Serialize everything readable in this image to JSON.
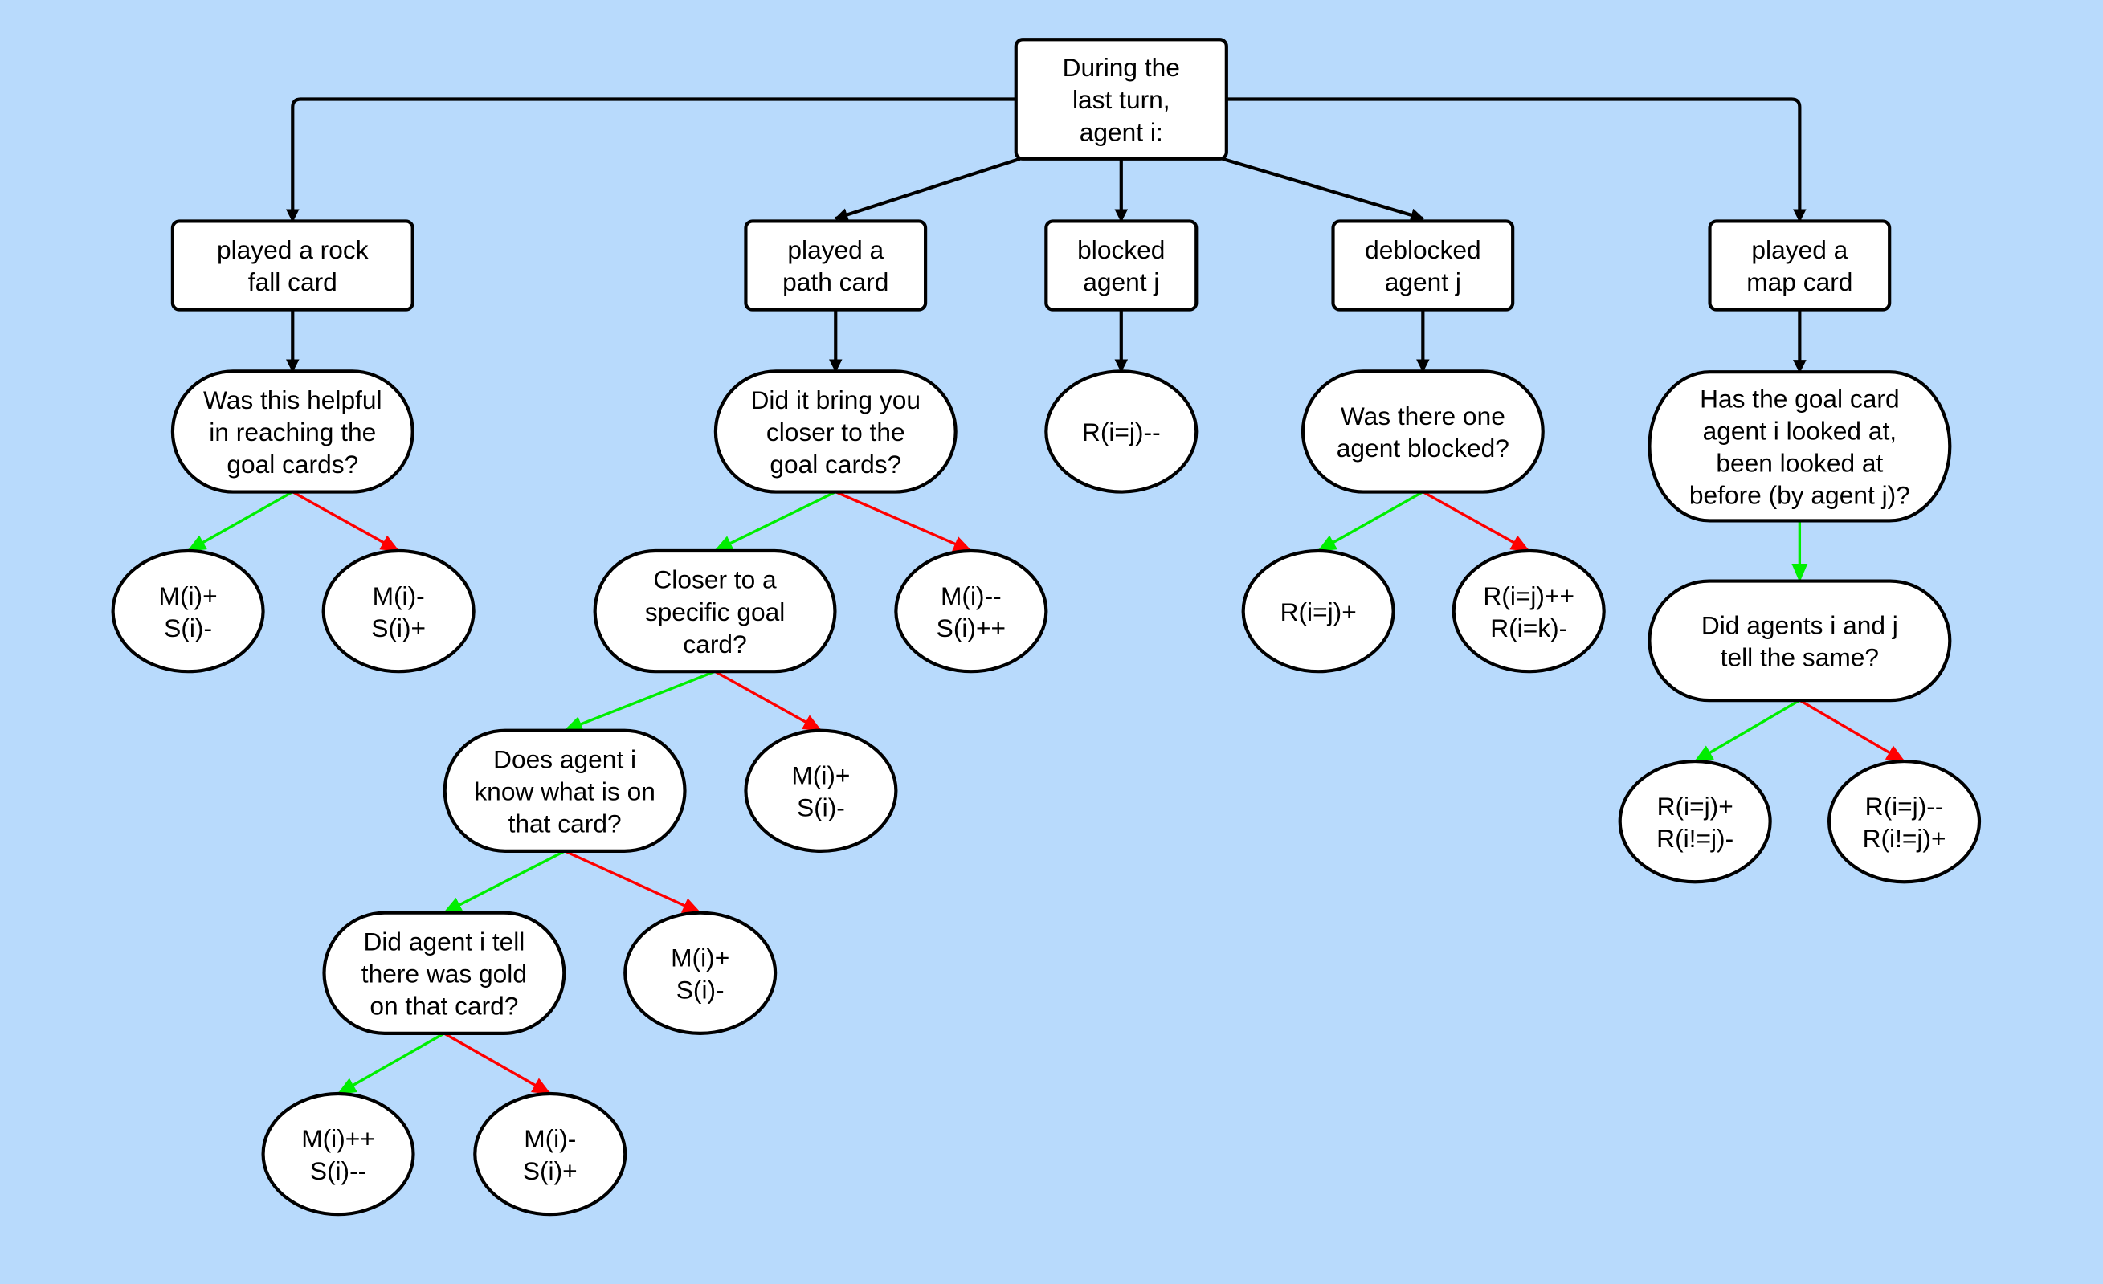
{
  "colors": {
    "background": "#b8dafc",
    "node_fill": "#ffffff",
    "stroke": "#000000",
    "yes_edge": "#00ee00",
    "no_edge": "#ff0000"
  },
  "nodes": {
    "root": [
      "During the",
      "last turn,",
      "agent i:"
    ],
    "rock": [
      "played a rock",
      "fall card"
    ],
    "path": [
      "played a",
      "path card"
    ],
    "blocked": [
      "blocked",
      "agent j"
    ],
    "deblocked": [
      "deblocked",
      "agent j"
    ],
    "map": [
      "played a",
      "map card"
    ],
    "q_rock": [
      "Was this helpful",
      "in reaching the",
      "goal cards?"
    ],
    "q_path": [
      "Did it bring you",
      "closer to the",
      "goal cards?"
    ],
    "l_blocked": [
      "R(i=j)--"
    ],
    "q_deb": [
      "Was there one",
      "agent blocked?"
    ],
    "q_map": [
      "Has the goal card",
      "agent i looked at,",
      "been looked at",
      "before (by agent j)?"
    ],
    "l_rock_yes": [
      "M(i)+",
      "S(i)-"
    ],
    "l_rock_no": [
      "M(i)-",
      "S(i)+"
    ],
    "q_closer": [
      "Closer to a",
      "specific goal",
      "card?"
    ],
    "l_path_no": [
      "M(i)--",
      "S(i)++"
    ],
    "l_deb_yes": [
      "R(i=j)+"
    ],
    "l_deb_no": [
      "R(i=j)++",
      "R(i=k)-"
    ],
    "q_same": [
      "Did agents i and j",
      "tell the same?"
    ],
    "q_know": [
      "Does agent i",
      "know what is on",
      "that card?"
    ],
    "l_closer_no": [
      "M(i)+",
      "S(i)-"
    ],
    "l_same_yes": [
      "R(i=j)+",
      "R(i!=j)-"
    ],
    "l_same_no": [
      "R(i=j)--",
      "R(i!=j)+"
    ],
    "q_gold": [
      "Did agent i tell",
      "there was gold",
      "on that card?"
    ],
    "l_know_no": [
      "M(i)+",
      "S(i)-"
    ],
    "l_gold_yes": [
      "M(i)++",
      "S(i)--"
    ],
    "l_gold_no": [
      "M(i)-",
      "S(i)+"
    ]
  },
  "edges": [
    {
      "from": "root",
      "to": "rock",
      "kind": "flow"
    },
    {
      "from": "root",
      "to": "path",
      "kind": "flow"
    },
    {
      "from": "root",
      "to": "blocked",
      "kind": "flow"
    },
    {
      "from": "root",
      "to": "deblocked",
      "kind": "flow"
    },
    {
      "from": "root",
      "to": "map",
      "kind": "flow"
    },
    {
      "from": "rock",
      "to": "q_rock",
      "kind": "flow"
    },
    {
      "from": "path",
      "to": "q_path",
      "kind": "flow"
    },
    {
      "from": "blocked",
      "to": "l_blocked",
      "kind": "flow"
    },
    {
      "from": "deblocked",
      "to": "q_deb",
      "kind": "flow"
    },
    {
      "from": "map",
      "to": "q_map",
      "kind": "flow"
    },
    {
      "from": "q_rock",
      "to": "l_rock_yes",
      "kind": "yes"
    },
    {
      "from": "q_rock",
      "to": "l_rock_no",
      "kind": "no"
    },
    {
      "from": "q_path",
      "to": "q_closer",
      "kind": "yes"
    },
    {
      "from": "q_path",
      "to": "l_path_no",
      "kind": "no"
    },
    {
      "from": "q_deb",
      "to": "l_deb_yes",
      "kind": "yes"
    },
    {
      "from": "q_deb",
      "to": "l_deb_no",
      "kind": "no"
    },
    {
      "from": "q_map",
      "to": "q_same",
      "kind": "yes"
    },
    {
      "from": "q_closer",
      "to": "q_know",
      "kind": "yes"
    },
    {
      "from": "q_closer",
      "to": "l_closer_no",
      "kind": "no"
    },
    {
      "from": "q_same",
      "to": "l_same_yes",
      "kind": "yes"
    },
    {
      "from": "q_same",
      "to": "l_same_no",
      "kind": "no"
    },
    {
      "from": "q_know",
      "to": "q_gold",
      "kind": "yes"
    },
    {
      "from": "q_know",
      "to": "l_know_no",
      "kind": "no"
    },
    {
      "from": "q_gold",
      "to": "l_gold_yes",
      "kind": "yes"
    },
    {
      "from": "q_gold",
      "to": "l_gold_no",
      "kind": "no"
    }
  ]
}
